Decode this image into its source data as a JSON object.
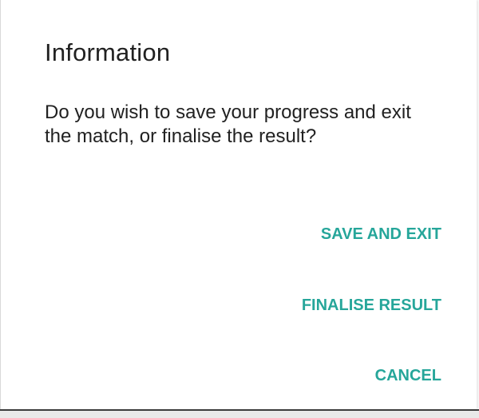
{
  "dialog": {
    "title": "Information",
    "message": "Do you wish to save your progress and exit the match, or finalise the result?",
    "actions": {
      "save_exit": "SAVE AND EXIT",
      "finalise": "FINALISE RESULT",
      "cancel": "CANCEL"
    }
  },
  "colors": {
    "accent": "#26a69a",
    "text": "#212121",
    "background": "#ffffff"
  }
}
